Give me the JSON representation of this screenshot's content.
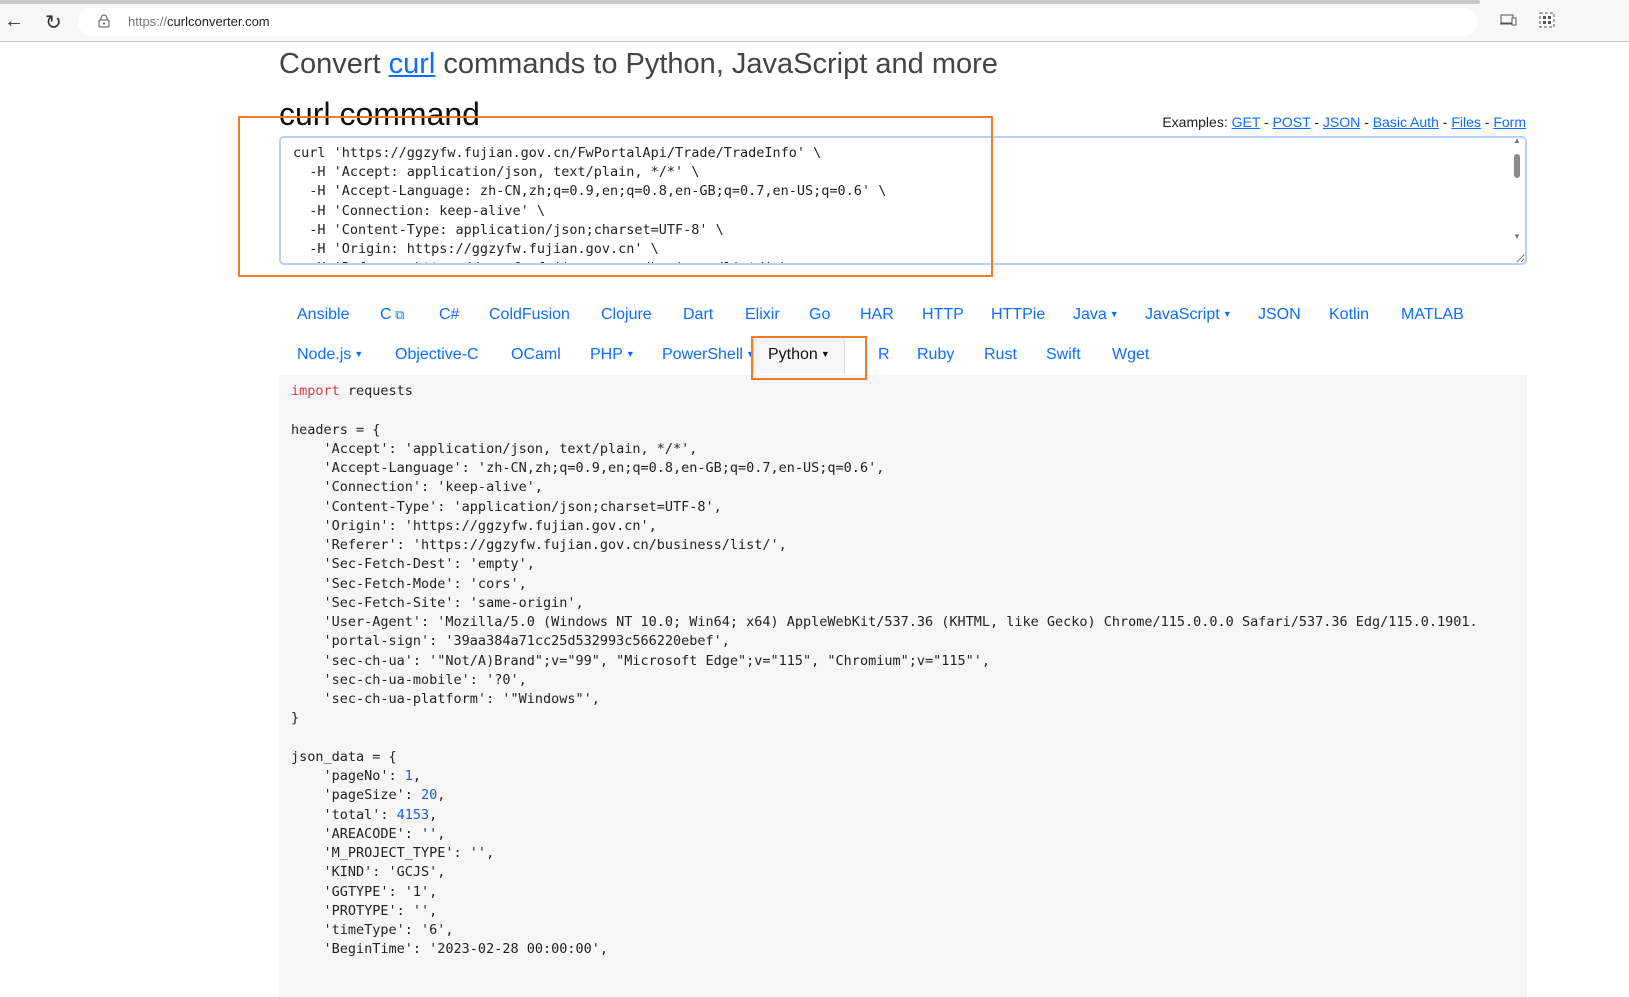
{
  "browser": {
    "url_prefix": "https://",
    "url_host": "curlconverter.com"
  },
  "header": {
    "title_pre": "Convert ",
    "title_link": "curl",
    "title_post": " commands to Python, JavaScript and more",
    "section": "curl command"
  },
  "examples": {
    "label": "Examples: ",
    "links": [
      "GET",
      "POST",
      "JSON",
      "Basic Auth",
      "Files",
      "Form"
    ]
  },
  "curl_input": "curl 'https://ggzyfw.fujian.gov.cn/FwPortalApi/Trade/TradeInfo' \\\n  -H 'Accept: application/json, text/plain, */*' \\\n  -H 'Accept-Language: zh-CN,zh;q=0.9,en;q=0.8,en-GB;q=0.7,en-US;q=0.6' \\\n  -H 'Connection: keep-alive' \\\n  -H 'Content-Type: application/json;charset=UTF-8' \\\n  -H 'Origin: https://ggzyfw.fujian.gov.cn' \\\n  -H 'Referer: https://ggzyfw.fujian.gov.cn/business/list/' \\",
  "languages_row1": [
    {
      "label": "Ansible"
    },
    {
      "label": "C",
      "external": true
    },
    {
      "label": "C#"
    },
    {
      "label": "ColdFusion"
    },
    {
      "label": "Clojure"
    },
    {
      "label": "Dart"
    },
    {
      "label": "Elixir"
    },
    {
      "label": "Go"
    },
    {
      "label": "HAR"
    },
    {
      "label": "HTTP"
    },
    {
      "label": "HTTPie"
    },
    {
      "label": "Java",
      "dropdown": true
    },
    {
      "label": "JavaScript",
      "dropdown": true
    },
    {
      "label": "JSON"
    },
    {
      "label": "Kotlin"
    },
    {
      "label": "MATLAB"
    }
  ],
  "languages_row2": [
    {
      "label": "Node.js",
      "dropdown": true
    },
    {
      "label": "Objective-C"
    },
    {
      "label": "OCaml"
    },
    {
      "label": "PHP",
      "dropdown": true
    },
    {
      "label": "PowerShell",
      "dropdown": true
    },
    {
      "label": "Python",
      "dropdown": true,
      "active": true
    },
    {
      "label": "R"
    },
    {
      "label": "Ruby"
    },
    {
      "label": "Rust"
    },
    {
      "label": "Swift"
    },
    {
      "label": "Wget"
    }
  ],
  "colors": {
    "link": "#0d6efd",
    "highlight": "#f47a2a",
    "keyword": "#d73a49"
  },
  "output_code": [
    "import requests",
    "",
    "headers = {",
    "    'Accept': 'application/json, text/plain, */*',",
    "    'Accept-Language': 'zh-CN,zh;q=0.9,en;q=0.8,en-GB;q=0.7,en-US;q=0.6',",
    "    'Connection': 'keep-alive',",
    "    'Content-Type': 'application/json;charset=UTF-8',",
    "    'Origin': 'https://ggzyfw.fujian.gov.cn',",
    "    'Referer': 'https://ggzyfw.fujian.gov.cn/business/list/',",
    "    'Sec-Fetch-Dest': 'empty',",
    "    'Sec-Fetch-Mode': 'cors',",
    "    'Sec-Fetch-Site': 'same-origin',",
    "    'User-Agent': 'Mozilla/5.0 (Windows NT 10.0; Win64; x64) AppleWebKit/537.36 (KHTML, like Gecko) Chrome/115.0.0.0 Safari/537.36 Edg/115.0.1901.",
    "    'portal-sign': '39aa384a71cc25d532993c566220ebef',",
    "    'sec-ch-ua': '\"Not/A)Brand\";v=\"99\", \"Microsoft Edge\";v=\"115\", \"Chromium\";v=\"115\"',",
    "    'sec-ch-ua-mobile': '?0',",
    "    'sec-ch-ua-platform': '\"Windows\"',",
    "}",
    "",
    "json_data = {",
    "    'pageNo': 1,",
    "    'pageSize': 20,",
    "    'total': 4153,",
    "    'AREACODE': '',",
    "    'M_PROJECT_TYPE': '',",
    "    'KIND': 'GCJS',",
    "    'GGTYPE': '1',",
    "    'PROTYPE': '',",
    "    'timeType': '6',",
    "    'BeginTime': '2023-02-28 00:00:00',"
  ]
}
